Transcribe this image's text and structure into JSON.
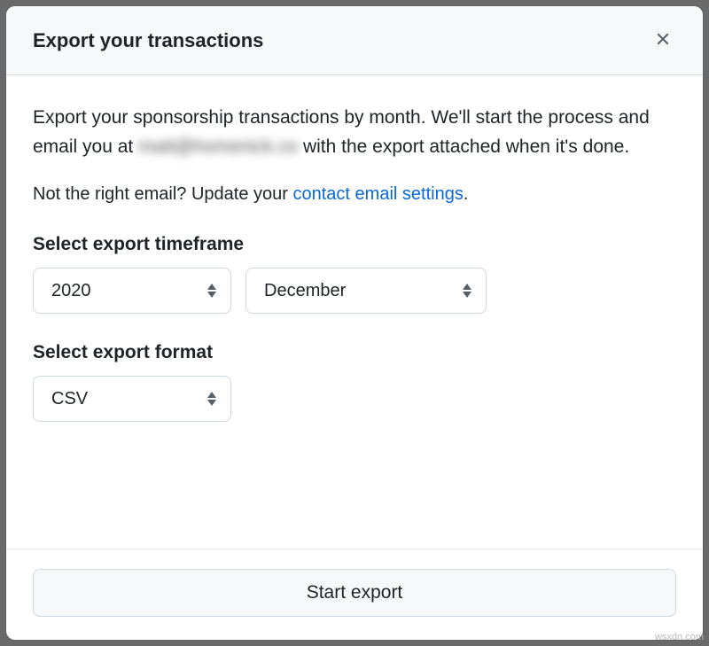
{
  "header": {
    "title": "Export your transactions"
  },
  "body": {
    "description_prefix": "Export your sponsorship transactions by month. We'll start the process and email you at ",
    "email_redacted": "matt@homenick.co",
    "description_suffix": " with the export attached when it's done.",
    "email_hint_prefix": "Not the right email? Update your ",
    "email_hint_link": "contact email settings",
    "email_hint_suffix": ".",
    "timeframe_label": "Select export timeframe",
    "year_value": "2020",
    "month_value": "December",
    "format_label": "Select export format",
    "format_value": "CSV"
  },
  "footer": {
    "start_label": "Start export"
  },
  "watermark": "wsxdn.com"
}
